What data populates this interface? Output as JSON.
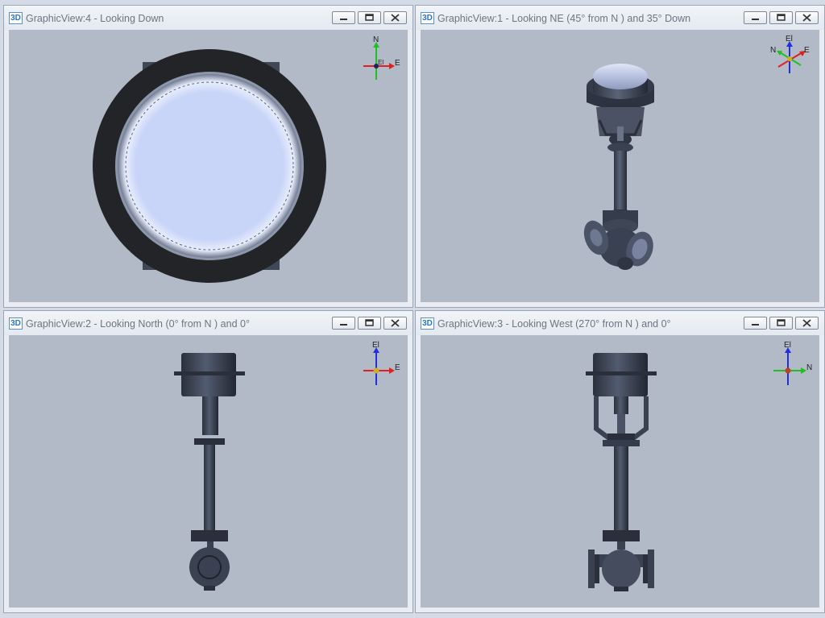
{
  "views": [
    {
      "id": "top-left",
      "icon_text": "3D",
      "title": "GraphicView:4 - Looking Down",
      "triad": {
        "label_up": "N",
        "label_right": "E",
        "label_center": "El"
      }
    },
    {
      "id": "top-right",
      "icon_text": "3D",
      "title": "GraphicView:1 - Looking NE (45° from N ) and 35° Down",
      "triad": {
        "label_up": "El",
        "label_left": "N",
        "label_right": "E"
      }
    },
    {
      "id": "bottom-left",
      "icon_text": "3D",
      "title": "GraphicView:2 - Looking North (0° from N ) and 0°",
      "triad": {
        "label_up": "El",
        "label_right": "E"
      }
    },
    {
      "id": "bottom-right",
      "icon_text": "3D",
      "title": "GraphicView:3 - Looking West (270° from N ) and 0°",
      "triad": {
        "label_up": "El",
        "label_right": "N"
      }
    }
  ],
  "window_buttons": [
    "minimize-icon",
    "restore-icon",
    "close-icon"
  ],
  "colors": {
    "viewport_bg": "#b3bac7",
    "model_dark": "#3a4150",
    "model_light": "#c8d4f5",
    "axis_red": "#e02020",
    "axis_green": "#20c020",
    "axis_blue": "#2030e0"
  }
}
